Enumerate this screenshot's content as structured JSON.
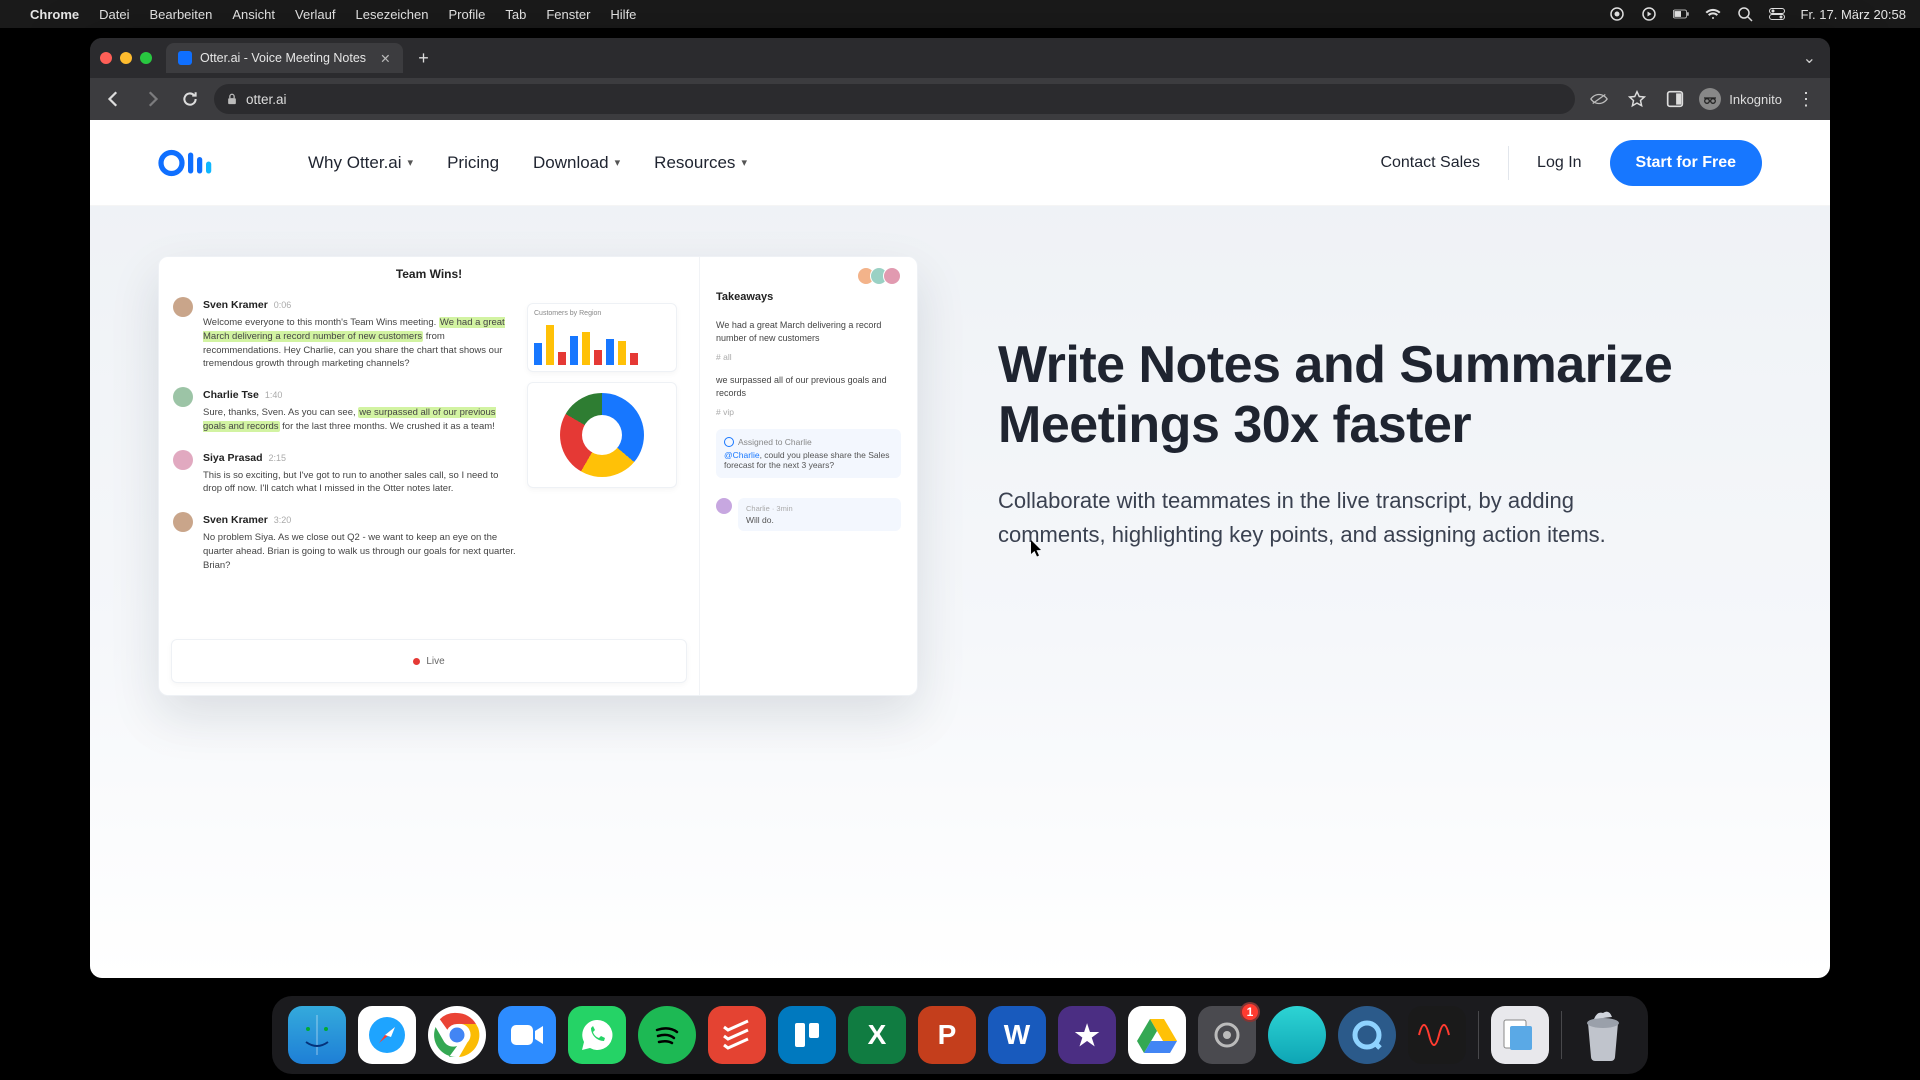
{
  "menubar": {
    "items": [
      "Chrome",
      "Datei",
      "Bearbeiten",
      "Ansicht",
      "Verlauf",
      "Lesezeichen",
      "Profile",
      "Tab",
      "Fenster",
      "Hilfe"
    ],
    "clock": "Fr. 17. März  20:58"
  },
  "browser": {
    "tab_title": "Otter.ai - Voice Meeting Notes",
    "url": "otter.ai",
    "profile_label": "Inkognito"
  },
  "nav": {
    "why": "Why Otter.ai",
    "pricing": "Pricing",
    "download": "Download",
    "resources": "Resources",
    "contact": "Contact Sales",
    "login": "Log In",
    "cta": "Start for Free"
  },
  "hero": {
    "heading": "Write Notes and Summarize Meetings 30x faster",
    "body": "Collaborate with teammates in the live transcript, by adding comments, highlighting key points, and assigning action items."
  },
  "mock": {
    "title": "Team Wins!",
    "live": "Live",
    "takeaways_title": "Takeaways",
    "chart_label": "Customers by Region",
    "hash_all": "# all",
    "hash_vip": "# vip",
    "transcript": [
      {
        "name": "Sven Kramer",
        "time": "0:06",
        "pre": "Welcome everyone to this month's Team Wins meeting. ",
        "hl": "We had a great March delivering a record number of new customers",
        "post": " from recommendations. Hey Charlie, can you share the chart that shows our tremendous growth through marketing channels?"
      },
      {
        "name": "Charlie Tse",
        "time": "1:40",
        "pre": "Sure, thanks, Sven. As you can see, ",
        "hl": "we surpassed all of our previous goals and records",
        "post": " for the last three months. We crushed it as a team!"
      },
      {
        "name": "Siya Prasad",
        "time": "2:15",
        "pre": "This is so exciting, but I've got to run to another sales call, so I need to drop off now. I'll catch what I missed in the Otter notes later.",
        "hl": "",
        "post": ""
      },
      {
        "name": "Sven Kramer",
        "time": "3:20",
        "pre": "No problem Siya. As we close out Q2 - we want to keep an eye on the quarter ahead. Brian is going to walk us through our goals for next quarter. Brian?",
        "hl": "",
        "post": ""
      }
    ],
    "takeaways": [
      "We had a great March delivering a record number of new customers",
      "we surpassed all of our previous goals and records"
    ],
    "action": {
      "assigned": "Assigned to Charlie",
      "mention": "@Charlie",
      "body": ", could you please share the Sales forecast for the next 3 years?"
    },
    "reply": {
      "meta": "Charlie · 3min",
      "body": "Will do."
    }
  },
  "dock": {
    "badge": "1"
  }
}
